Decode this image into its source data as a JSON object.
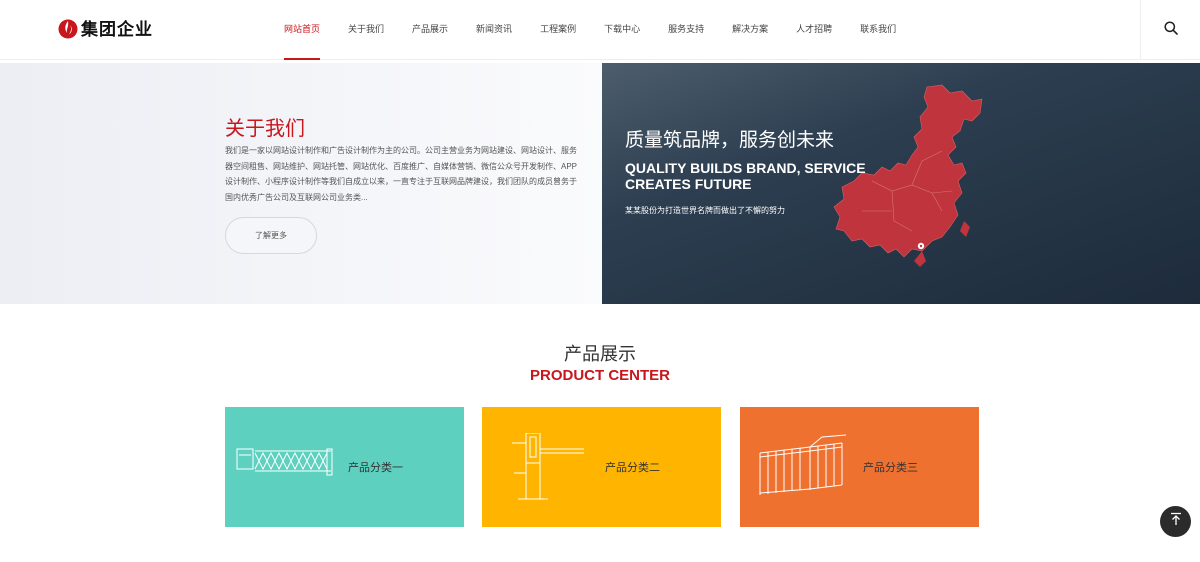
{
  "header": {
    "logo_text": "集团企业",
    "nav": [
      {
        "label": "网站首页",
        "active": true
      },
      {
        "label": "关于我们"
      },
      {
        "label": "产品展示"
      },
      {
        "label": "新闻资讯"
      },
      {
        "label": "工程案例"
      },
      {
        "label": "下载中心"
      },
      {
        "label": "服务支持"
      },
      {
        "label": "解决方案"
      },
      {
        "label": "人才招聘"
      },
      {
        "label": "联系我们"
      }
    ],
    "search_icon": "search-icon"
  },
  "about": {
    "title": "关于我们",
    "text": "我们是一家以网站设计制作和广告设计制作为主的公司。公司主营业务为网站建设、网站设计、服务器空间租售、网站维护、网站托管、网站优化、百度推广、自媒体营销、微信公众号开发制作、APP设计制作、小程序设计制作等我们自成立以来，一直专注于互联网品牌建设，我们团队的成员曾务于国内优秀广告公司及互联网公司业务类...",
    "more_label": "了解更多"
  },
  "banner": {
    "title_cn": "质量筑品牌，服务创未来",
    "title_en": "QUALITY BUILDS BRAND, SERVICE CREATES FUTURE",
    "subtitle": "某某股份为打造世界名牌而做出了不懈的努力",
    "colors": {
      "background": "#1f2d3d",
      "map": "#c0353d"
    }
  },
  "products": {
    "title_cn": "产品展示",
    "title_en": "PRODUCT CENTER",
    "cards": [
      {
        "label": "产品分类一",
        "color": "#5dd0c0",
        "icon": "retractable-gate-icon"
      },
      {
        "label": "产品分类二",
        "color": "#ffb400",
        "icon": "barrier-gate-icon"
      },
      {
        "label": "产品分类三",
        "color": "#ee7130",
        "icon": "railing-fence-icon"
      }
    ]
  },
  "back_to_top_icon": "back-to-top-icon",
  "colors": {
    "accent": "#c8161d"
  }
}
